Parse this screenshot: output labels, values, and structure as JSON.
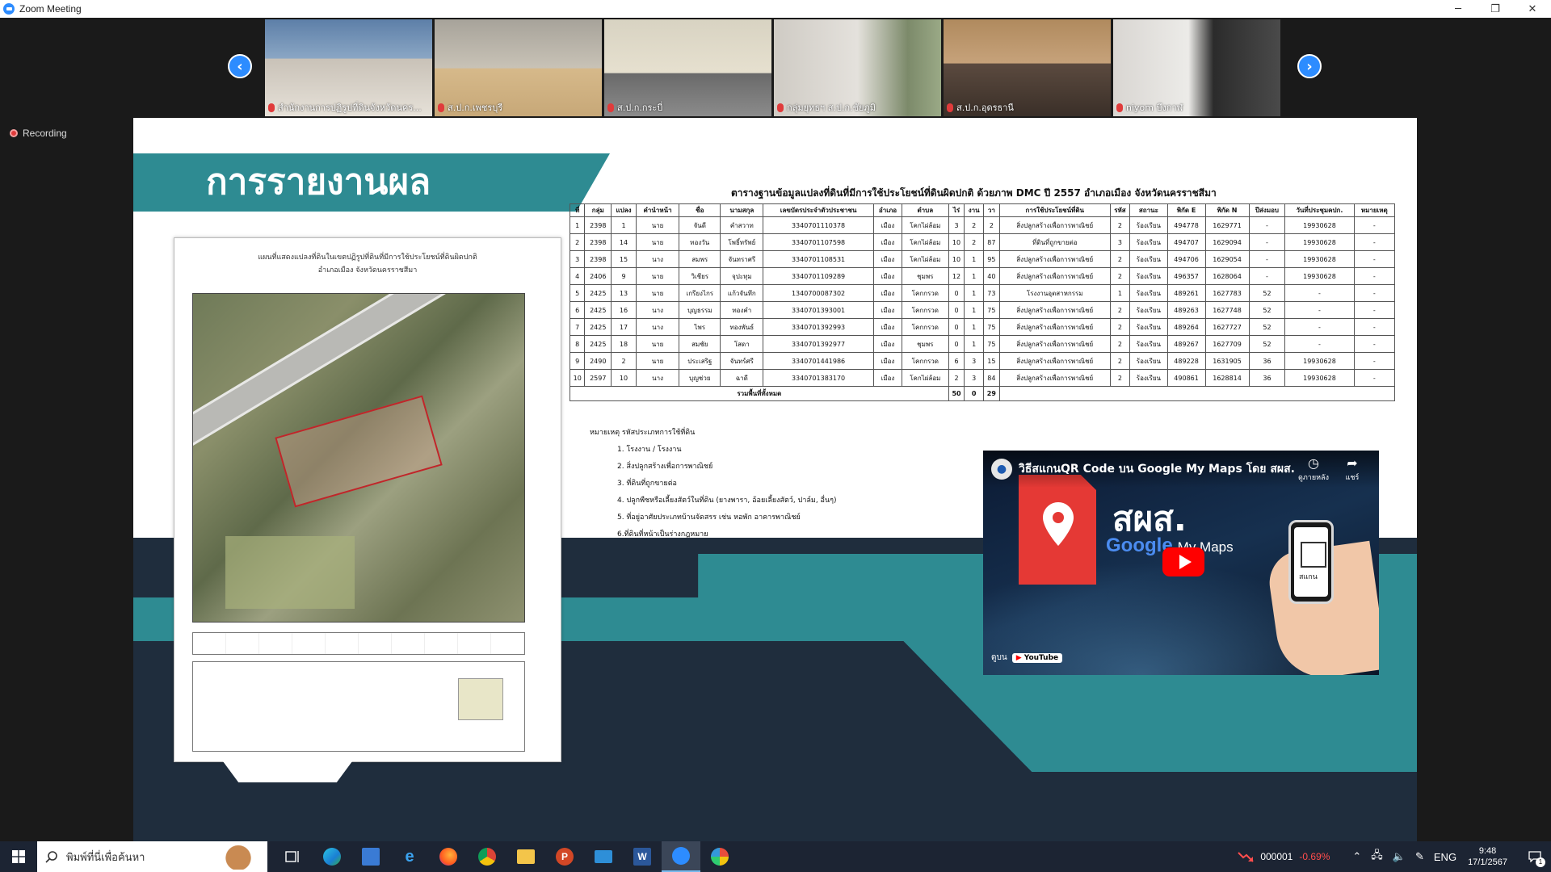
{
  "window": {
    "title": "Zoom Meeting",
    "controls": {
      "minimize": "─",
      "restore": "❐",
      "close": "✕"
    }
  },
  "participants": [
    {
      "name": "สำนักงานการปฏิรูปที่ดินจังหวัดนคร...",
      "muted": true
    },
    {
      "name": "ส.ป.ก.เพชรบุรี",
      "muted": true
    },
    {
      "name": "ส.ป.ก.กระบี่",
      "muted": true
    },
    {
      "name": "กลุ่มยุทธฯ ส.ป.ก.ชัยภูมิ",
      "muted": true
    },
    {
      "name": "ส.ป.ก.อุดรธานี",
      "muted": true
    },
    {
      "name": "niyom บึงกาฬ",
      "muted": true
    }
  ],
  "nav": {
    "prev": "‹",
    "next": "›"
  },
  "recording": {
    "label": "Recording"
  },
  "slide": {
    "heading": "การรายงานผล",
    "map": {
      "title": "แผนที่แสดงแปลงที่ดินในเขตปฏิรูปที่ดินที่มีการใช้ประโยชน์ที่ดินผิดปกติ",
      "subtitle": "อำเภอเมือง จังหวัดนครราชสีมา"
    },
    "table_title": "ตารางฐานข้อมูลแปลงที่ดินที่มีการใช้ประโยชน์ที่ดินผิดปกติ ด้วยภาพ DMC ปี 2557 อำเภอเมือง จังหวัดนครราชสีมา",
    "table_headers": [
      "ที่",
      "กลุ่ม",
      "แปลง",
      "คำนำหน้า",
      "ชื่อ",
      "นามสกุล",
      "เลขบัตรประจำตัวประชาชน",
      "อำเภอ",
      "ตำบล",
      "ไร่",
      "งาน",
      "วา",
      "การใช้ประโยชน์ที่ดิน",
      "รหัส",
      "สถานะ",
      "พิกัด E",
      "พิกัด N",
      "ปีส่งมอบ",
      "วันที่ประชุมคปก.",
      "หมายเหตุ"
    ],
    "table_rows": [
      [
        "1",
        "2398",
        "1",
        "นาย",
        "จันดี",
        "คำสวาท",
        "3340701110378",
        "เมือง",
        "โคกไผ่ล้อม",
        "3",
        "2",
        "2",
        "สิ่งปลูกสร้างเพื่อการพาณิชย์",
        "2",
        "ร้องเรียน",
        "494778",
        "1629771",
        "-",
        "19930628",
        "-"
      ],
      [
        "2",
        "2398",
        "14",
        "นาย",
        "ทองวัน",
        "โพธิ์ทรัพย์",
        "3340701107598",
        "เมือง",
        "โคกไผ่ล้อม",
        "10",
        "2",
        "87",
        "ที่ดินที่ถูกขายต่อ",
        "3",
        "ร้องเรียน",
        "494707",
        "1629094",
        "-",
        "19930628",
        "-"
      ],
      [
        "3",
        "2398",
        "15",
        "นาง",
        "สมพร",
        "จันทราศรี",
        "3340701108531",
        "เมือง",
        "โคกไผ่ล้อม",
        "10",
        "1",
        "95",
        "สิ่งปลูกสร้างเพื่อการพาณิชย์",
        "2",
        "ร้องเรียน",
        "494706",
        "1629054",
        "-",
        "19930628",
        "-"
      ],
      [
        "4",
        "2406",
        "9",
        "นาย",
        "วิเชียร",
        "จุปะทุม",
        "3340701109289",
        "เมือง",
        "ชุมพร",
        "12",
        "1",
        "40",
        "สิ่งปลูกสร้างเพื่อการพาณิชย์",
        "2",
        "ร้องเรียน",
        "496357",
        "1628064",
        "-",
        "19930628",
        "-"
      ],
      [
        "5",
        "2425",
        "13",
        "นาย",
        "เกรียงไกร",
        "แก้วจันทึก",
        "1340700087302",
        "เมือง",
        "โคกกรวด",
        "0",
        "1",
        "73",
        "โรงงานอุตสาหกรรม",
        "1",
        "ร้องเรียน",
        "489261",
        "1627783",
        "52",
        "-",
        "-"
      ],
      [
        "6",
        "2425",
        "16",
        "นาง",
        "บุญธรรม",
        "ทองคำ",
        "3340701393001",
        "เมือง",
        "โคกกรวด",
        "0",
        "1",
        "75",
        "สิ่งปลูกสร้างเพื่อการพาณิชย์",
        "2",
        "ร้องเรียน",
        "489263",
        "1627748",
        "52",
        "-",
        "-"
      ],
      [
        "7",
        "2425",
        "17",
        "นาง",
        "ไพร",
        "ทองพันธ์",
        "3340701392993",
        "เมือง",
        "โคกกรวด",
        "0",
        "1",
        "75",
        "สิ่งปลูกสร้างเพื่อการพาณิชย์",
        "2",
        "ร้องเรียน",
        "489264",
        "1627727",
        "52",
        "-",
        "-"
      ],
      [
        "8",
        "2425",
        "18",
        "นาย",
        "สมชัย",
        "โสดา",
        "3340701392977",
        "เมือง",
        "ชุมพร",
        "0",
        "1",
        "75",
        "สิ่งปลูกสร้างเพื่อการพาณิชย์",
        "2",
        "ร้องเรียน",
        "489267",
        "1627709",
        "52",
        "-",
        "-"
      ],
      [
        "9",
        "2490",
        "2",
        "นาย",
        "ประเสริฐ",
        "จันทร์ศรี",
        "3340701441986",
        "เมือง",
        "โคกกรวด",
        "6",
        "3",
        "15",
        "สิ่งปลูกสร้างเพื่อการพาณิชย์",
        "2",
        "ร้องเรียน",
        "489228",
        "1631905",
        "36",
        "19930628",
        "-"
      ],
      [
        "10",
        "2597",
        "10",
        "นาง",
        "บุญช่วย",
        "ฉาดี",
        "3340701383170",
        "เมือง",
        "โคกไผ่ล้อม",
        "2",
        "3",
        "84",
        "สิ่งปลูกสร้างเพื่อการพาณิชย์",
        "2",
        "ร้องเรียน",
        "490861",
        "1628814",
        "36",
        "19930628",
        "-"
      ]
    ],
    "table_total": {
      "label": "รวมพื้นที่ทั้งหมด",
      "rai": "50",
      "ngan": "0",
      "wa": "29"
    },
    "remarks": {
      "title": "หมายเหตุ รหัสประเภทการใช้ที่ดิน",
      "items": [
        "1. โรงงาน / โรงงาน",
        "2. สิ่งปลูกสร้างเพื่อการพาณิชย์",
        "3. ที่ดินที่ถูกขายต่อ",
        "4. ปลูกพืชหรือเลี้ยงสัตว์ในที่ดิน (ยางพารา, อ้อยเลี้ยงสัตว์, ปาล์ม, อื่นๆ)",
        "5. ที่อยู่อาศัยประเภทบ้านจัดสรร เช่น หอพัก อาคารพาณิชย์",
        "6.ที่ดินที่หน้าเป็นร่างกฎหมาย"
      ]
    },
    "video": {
      "title": "วิธีสแกนQR Code บน Google My Maps โดย สผส.",
      "watch_later": "ดูภายหลัง",
      "share": "แชร์",
      "brand": "สผส.",
      "google": "Google",
      "my_maps": "My Maps",
      "phone_label": "สแกน",
      "watch_on": "ดูบน",
      "youtube": "YouTube"
    }
  },
  "taskbar": {
    "search_placeholder": "พิมพ์ที่นี่เพื่อค้นหา",
    "stock_code": "000001",
    "stock_change": "-0.69%",
    "language": "ENG",
    "time": "9:48",
    "date": "17/1/2567",
    "notifications": "1",
    "app_letters": {
      "powerpoint": "P",
      "word": "W"
    }
  },
  "colors": {
    "teal": "#2e8b92",
    "navy": "#1f2d3d",
    "zoom_blue": "#2d8cff",
    "recording_red": "#e03b3b"
  }
}
